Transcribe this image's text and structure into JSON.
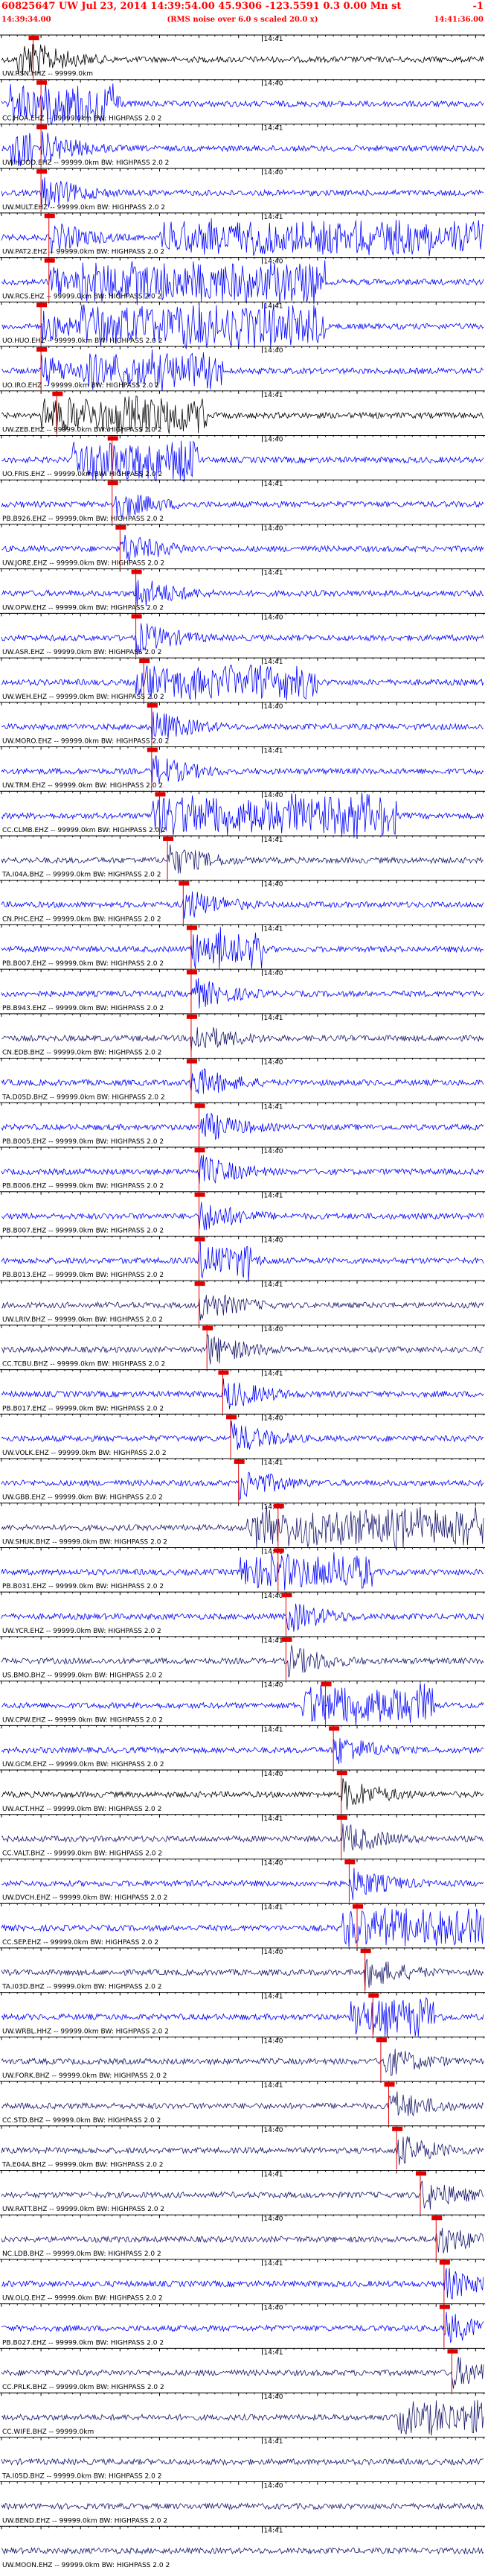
{
  "header": {
    "title": "60825647 UW Jul 23, 2014 14:39:54.00   45.9306 -123.5591  0.3 0.00  Mn st",
    "right_marker": "-1",
    "start_time": "14:39:34.00",
    "rms_note": "(RMS noise over 6.0 s scaled 20.0 x)",
    "end_time": "14:41:36.00"
  },
  "chart_data": {
    "type": "line",
    "title": "60825647 UW Jul 23, 2014 14:39:54.00   45.9306 -123.5591  0.3 0.00  Mn st",
    "x_range_seconds": [
      0,
      122
    ],
    "tick_every_seconds": 2,
    "minute_tick_seconds": 66,
    "minute_tick_labels": [
      "14:41",
      "14:40"
    ],
    "trace_labels": [
      "UW.RSN.HHZ -- 99999.0km",
      "CC.HOA.EHZ -- 99999.0km BW: HIGHPASS  2.0  2",
      "UW.HOOD.EHZ -- 99999.0km BW: HIGHPASS  2.0  2",
      "UW.MULT.EHZ -- 99999.0km BW: HIGHPASS  2.0  2",
      "UW.PAT2.EHZ -- 99999.0km BW: HIGHPASS  2.0  2",
      "UW.RCS.EHZ -- 99999.0km BW: HIGHPASS  2.0  2",
      "UO.HUO.EHZ -- 99999.0km BW: HIGHPASS  2.0  2",
      "UO.IRO.EHZ -- 99999.0km BW: HIGHPASS  2.0  2",
      "UW.ZEB.EHZ -- 99999.0km BW: HIGHPASS  2.0  2",
      "UO.FRIS.EHZ -- 99999.0km BW: HIGHPASS  2.0  2",
      "PB.B926.EHZ -- 99999.0km BW: HIGHPASS  2.0  2",
      "UW.JORE.EHZ -- 99999.0km BW: HIGHPASS  2.0  2",
      "UW.OPW.EHZ -- 99999.0km BW: HIGHPASS  2.0  2",
      "UW.ASR.EHZ -- 99999.0km BW: HIGHPASS  2.0  2",
      "UW.WEH.EHZ -- 99999.0km BW: HIGHPASS  2.0  2",
      "UW.MORO.EHZ -- 99999.0km BW: HIGHPASS  2.0  2",
      "UW.TRM.EHZ -- 99999.0km BW: HIGHPASS  2.0  2",
      "CC.CLMB.EHZ -- 99999.0km BW: HIGHPASS  2.0  2",
      "TA.I04A.BHZ -- 99999.0km BW: HIGHPASS  2.0  2",
      "CN.PHC.EHZ -- 99999.0km BW: HIGHPASS  2.0  2",
      "PB.B007.EHZ -- 99999.0km BW: HIGHPASS  2.0  2",
      "PB.B943.EHZ -- 99999.0km BW: HIGHPASS  2.0  2",
      "CN.EDB.BHZ -- 99999.0km BW: HIGHPASS  2.0  2",
      "TA.D05D.BHZ -- 99999.0km BW: HIGHPASS  2.0  2",
      "PB.B005.EHZ -- 99999.0km BW: HIGHPASS  2.0  2",
      "PB.B006.EHZ -- 99999.0km BW: HIGHPASS  2.0  2",
      "PB.B007.EHZ -- 99999.0km BW: HIGHPASS  2.0  2",
      "PB.B013.EHZ -- 99999.0km BW: HIGHPASS  2.0  2",
      "UW.LRIV.BHZ -- 99999.0km BW: HIGHPASS  2.0  2",
      "CC.TCBU.BHZ -- 99999.0km BW: HIGHPASS  2.0  2",
      "PB.B017.EHZ -- 99999.0km BW: HIGHPASS  2.0  2",
      "UW.VOLK.EHZ -- 99999.0km BW: HIGHPASS  2.0  2",
      "UW.GBB.EHZ -- 99999.0km BW: HIGHPASS  2.0  2",
      "UW.SHUK.BHZ -- 99999.0km BW: HIGHPASS  2.0  2",
      "PB.B031.EHZ -- 99999.0km BW: HIGHPASS  2.0  2",
      "UW.YCR.EHZ -- 99999.0km BW: HIGHPASS  2.0  2",
      "US.BMO.BHZ -- 99999.0km BW: HIGHPASS  2.0  2",
      "UW.CPW.EHZ -- 99999.0km BW: HIGHPASS  2.0  2",
      "UW.GCM.EHZ -- 99999.0km BW: HIGHPASS  2.0  2",
      "UW.ACT.HHZ -- 99999.0km BW: HIGHPASS  2.0  2",
      "CC.VALT.BHZ -- 99999.0km BW: HIGHPASS  2.0  2",
      "UW.DVCH.EHZ -- 99999.0km BW: HIGHPASS  2.0  2",
      "CC.SEP.EHZ -- 99999.0km BW: HIGHPASS  2.0  2",
      "TA.I03D.BHZ -- 99999.0km BW: HIGHPASS  2.0  2",
      "UW.WRBL.HHZ -- 99999.0km BW: HIGHPASS  2.0  2",
      "UW.FORK.BHZ -- 99999.0km BW: HIGHPASS  2.0  2",
      "CC.STD.BHZ -- 99999.0km BW: HIGHPASS  2.0  2",
      "TA.E04A.BHZ -- 99999.0km BW: HIGHPASS  2.0  2",
      "UW.RATT.BHZ -- 99999.0km BW: HIGHPASS  2.0  2",
      "NC.LDB.BHZ -- 99999.0km BW: HIGHPASS  2.0  2",
      "UW.OLQ.EHZ -- 99999.0km BW: HIGHPASS  2.0  2",
      "PB.B027.EHZ -- 99999.0km BW: HIGHPASS  2.0  2",
      "CC.PRLK.BHZ -- 99999.0km BW: HIGHPASS  2.0  2",
      "CC.WIFE.BHZ -- 99999.0km",
      "TA.I05D.BHZ -- 99999.0km BW: HIGHPASS  2.0  2",
      "UW.BEND.EHZ -- 99999.0km BW: HIGHPASS  2.0  2",
      "UW.MOON.EHZ -- 99999.0km BW: HIGHPASS  2.0  2"
    ],
    "trace_colors": [
      "#000000",
      "#0000ff",
      "#0000ff",
      "#0000ff",
      "#0000ff",
      "#0000ff",
      "#0000ff",
      "#0000ff",
      "#000000",
      "#0000ff",
      "#0000ff",
      "#0000ff",
      "#0000ff",
      "#0000ff",
      "#0000ff",
      "#0000ff",
      "#0000ff",
      "#0000ff",
      "#1a1a6e",
      "#0000ff",
      "#0000ff",
      "#0000ff",
      "#1a1a6e",
      "#0000ff",
      "#0000ff",
      "#0000ff",
      "#0000ff",
      "#0000ff",
      "#1a1a6e",
      "#1a1a6e",
      "#0000ff",
      "#0000ff",
      "#0000ff",
      "#1a1a6e",
      "#0000ff",
      "#0000ff",
      "#1a1a6e",
      "#0000ff",
      "#0000ff",
      "#000000",
      "#1a1a6e",
      "#0000ff",
      "#0000ff",
      "#1a1a6e",
      "#0000ff",
      "#1a1a6e",
      "#1a1a6e",
      "#1a1a6e",
      "#1a1a6e",
      "#1a1a6e",
      "#0000ff",
      "#0000ff",
      "#1a1a6e",
      "#1a1a6e",
      "#1a1a6e",
      "#1a1a6e",
      "#1a1a6e"
    ],
    "pick_seconds": [
      8,
      10,
      10,
      10,
      12,
      12,
      10,
      10,
      14,
      28,
      28,
      30,
      34,
      34,
      36,
      38,
      38,
      40,
      42,
      46,
      48,
      48,
      48,
      48,
      50,
      50,
      50,
      50,
      50,
      52,
      56,
      58,
      60,
      70,
      70,
      72,
      72,
      82,
      84,
      86,
      86,
      88,
      90,
      92,
      94,
      96,
      98,
      100,
      106,
      110,
      112,
      112,
      114,
      null,
      null,
      null,
      null
    ],
    "burst_envelopes": [
      {
        "trace": 0,
        "start": 4,
        "end": 9,
        "amp": 0.9
      },
      {
        "trace": 1,
        "start": 2,
        "end": 30,
        "amp": 1.0
      },
      {
        "trace": 2,
        "start": 2,
        "end": 8,
        "amp": 0.9
      },
      {
        "trace": 4,
        "start": 40,
        "end": 122,
        "amp": 0.8
      },
      {
        "trace": 5,
        "start": 20,
        "end": 82,
        "amp": 1.0
      },
      {
        "trace": 6,
        "start": 20,
        "end": 82,
        "amp": 1.0
      },
      {
        "trace": 7,
        "start": 20,
        "end": 56,
        "amp": 0.9
      },
      {
        "trace": 8,
        "start": 10,
        "end": 52,
        "amp": 0.9
      },
      {
        "trace": 9,
        "start": 18,
        "end": 50,
        "amp": 1.0
      },
      {
        "trace": 14,
        "start": 34,
        "end": 80,
        "amp": 0.8
      },
      {
        "trace": 17,
        "start": 38,
        "end": 100,
        "amp": 1.0
      },
      {
        "trace": 20,
        "start": 48,
        "end": 66,
        "amp": 1.0
      },
      {
        "trace": 27,
        "start": 50,
        "end": 64,
        "amp": 0.9
      },
      {
        "trace": 33,
        "start": 62,
        "end": 122,
        "amp": 0.9
      },
      {
        "trace": 34,
        "start": 60,
        "end": 94,
        "amp": 0.9
      },
      {
        "trace": 37,
        "start": 76,
        "end": 110,
        "amp": 1.0
      },
      {
        "trace": 42,
        "start": 86,
        "end": 122,
        "amp": 0.9
      },
      {
        "trace": 44,
        "start": 88,
        "end": 110,
        "amp": 0.9
      },
      {
        "trace": 53,
        "start": 100,
        "end": 122,
        "amp": 0.8
      }
    ],
    "legend": "none",
    "grid": false
  }
}
